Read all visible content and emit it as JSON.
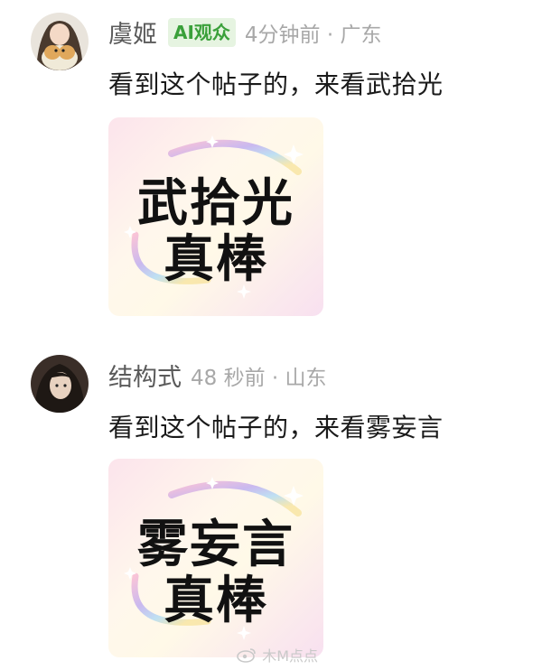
{
  "comments": [
    {
      "username": "虞姬",
      "badge": "AI观众",
      "time": "4分钟前 · 广东",
      "text": "看到这个帖子的，来看武拾光",
      "card": {
        "name": "武拾光",
        "praise": "真棒"
      },
      "colors": {
        "avatar_bg": "#7a6a5a"
      }
    },
    {
      "username": "结构式",
      "badge": "",
      "time": "48 秒前 · 山东",
      "text": "看到这个帖子的，来看雾妄言",
      "card": {
        "name": "雾妄言",
        "praise": "真棒"
      },
      "colors": {
        "avatar_bg": "#3a2e28"
      }
    }
  ],
  "watermark": {
    "text": "木M点点",
    "icon": "weibo-icon"
  },
  "colors": {
    "badge_bg": "#e6f4e1",
    "badge_text": "#3aa03a",
    "username": "#5a5a5a",
    "time": "#a8a8a8",
    "body_text": "#1a1a1a"
  }
}
